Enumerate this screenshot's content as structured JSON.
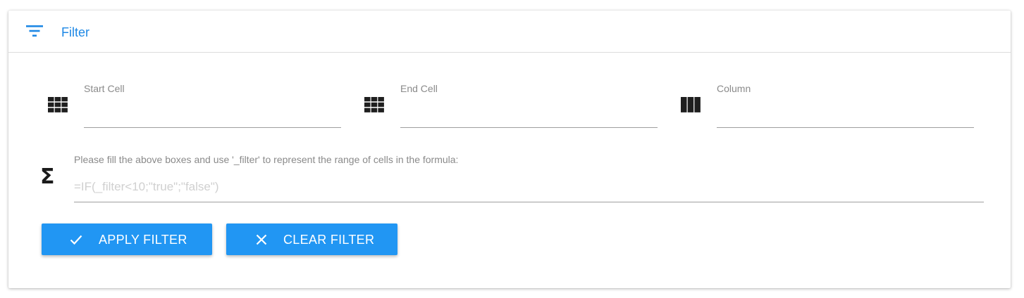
{
  "header": {
    "icon": "filter-icon",
    "title": "Filter"
  },
  "fields": {
    "start_cell": {
      "icon": "grid-icon",
      "label": "Start Cell",
      "value": ""
    },
    "end_cell": {
      "icon": "grid-icon",
      "label": "End Cell",
      "value": ""
    },
    "column": {
      "icon": "column-icon",
      "label": "Column",
      "value": ""
    }
  },
  "formula": {
    "icon": "sigma-icon",
    "label": "Please fill the above boxes and use '_filter' to represent the range of cells in the formula:",
    "placeholder": "=IF(_filter<10;\"true\";\"false\")",
    "value": ""
  },
  "buttons": {
    "apply": {
      "icon": "check-icon",
      "label": "APPLY FILTER"
    },
    "clear": {
      "icon": "close-icon",
      "label": "CLEAR FILTER"
    }
  },
  "colors": {
    "accent": "#1e88e5",
    "button": "#2196f3",
    "label": "#8a8a8a"
  }
}
